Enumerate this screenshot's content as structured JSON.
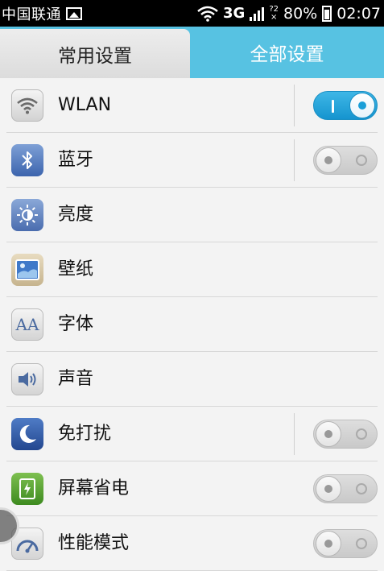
{
  "status_bar": {
    "carrier": "中国联通",
    "network": "3G",
    "battery": "80%",
    "time": "02:07",
    "icons": [
      "image-icon",
      "wifi-icon",
      "signal-icon",
      "sim-icon",
      "battery-icon"
    ]
  },
  "tabs": [
    {
      "label": "常用设置",
      "selected": true
    },
    {
      "label": "全部设置",
      "selected": false
    }
  ],
  "settings": [
    {
      "label": "WLAN",
      "icon": "wifi-icon",
      "toggle": "on"
    },
    {
      "label": "蓝牙",
      "icon": "bluetooth-icon",
      "toggle": "off"
    },
    {
      "label": "亮度",
      "icon": "brightness-icon"
    },
    {
      "label": "壁纸",
      "icon": "wallpaper-icon"
    },
    {
      "label": "字体",
      "icon": "font-icon",
      "icon_text": "AA"
    },
    {
      "label": "声音",
      "icon": "speaker-icon"
    },
    {
      "label": "免打扰",
      "icon": "moon-icon",
      "toggle": "off"
    },
    {
      "label": "屏幕省电",
      "icon": "battery-saver-icon",
      "toggle": "off"
    },
    {
      "label": "性能模式",
      "icon": "gauge-icon",
      "toggle": "off"
    }
  ],
  "colors": {
    "accent": "#57c2e2",
    "toggle_on": "#1a9fd8",
    "status_bar_bg": "#000000"
  }
}
